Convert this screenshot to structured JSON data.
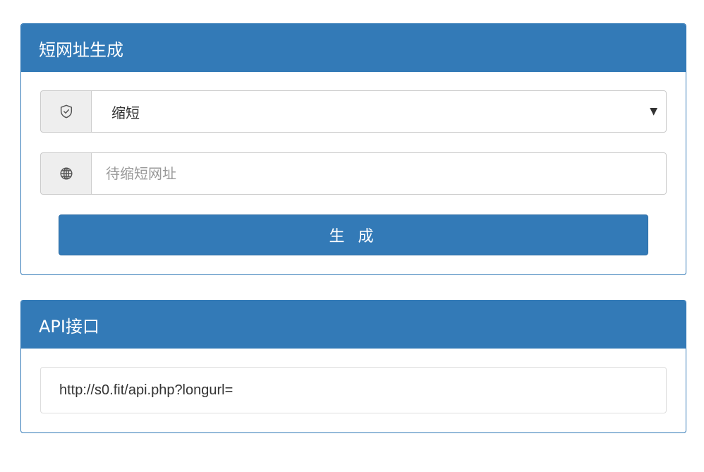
{
  "shortener_panel": {
    "title": "短网址生成",
    "mode_select": {
      "icon": "shield-icon",
      "selected": "缩短",
      "arrow": "▼"
    },
    "url_input": {
      "icon": "globe-icon",
      "placeholder": "待缩短网址",
      "value": ""
    },
    "generate_label": "生 成"
  },
  "api_panel": {
    "title": "API接口",
    "endpoint": "http://s0.fit/api.php?longurl="
  },
  "colors": {
    "primary": "#337ab7",
    "addon_bg": "#eeeeee",
    "border": "#cccccc"
  }
}
